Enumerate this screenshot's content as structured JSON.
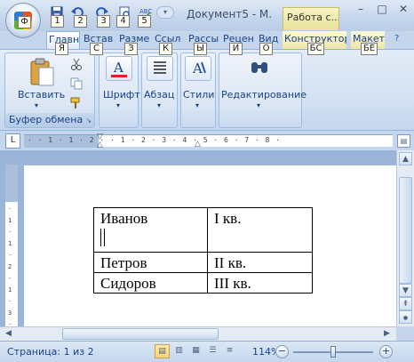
{
  "title": {
    "document": "Документ5 - М.",
    "context_tab": "Работа с...",
    "window_buttons": [
      "–",
      "□",
      "✕"
    ]
  },
  "quick_access": {
    "keytips": [
      "1",
      "2",
      "3",
      "4",
      "5"
    ],
    "office_keytip": "Ф"
  },
  "tabs": [
    {
      "label": "Главн",
      "keytip": "Я"
    },
    {
      "label": "Встав",
      "keytip": "С"
    },
    {
      "label": "Разме",
      "keytip": "З"
    },
    {
      "label": "Ссыл",
      "keytip": "К"
    },
    {
      "label": "Рассы",
      "keytip": "Ы"
    },
    {
      "label": "Рецен",
      "keytip": "И"
    },
    {
      "label": "Вид",
      "keytip": "О"
    },
    {
      "label": "Конструктор",
      "keytip": "БС"
    },
    {
      "label": "Макет",
      "keytip": "БЕ"
    }
  ],
  "ribbon": {
    "paste_label": "Вставить",
    "clipboard_group": "Буфер обмена",
    "font_label": "Шрифт",
    "paragraph_label": "Абзац",
    "styles_label": "Стили",
    "editing_label": "Редактирование"
  },
  "ruler": {
    "tab_button": "L",
    "horizontal": "· · 1 · 1 · 2 ·    · 1 · 2 · 3 · 4 · 5 · 6 · 7 · 8 ·",
    "vertical": "· 1 · 1 · 2 · 1 · 3 · 1 · 4"
  },
  "table": {
    "rows": [
      {
        "name": "Иванов",
        "quarter": "I кв."
      },
      {
        "name": "Петров",
        "quarter": "II кв."
      },
      {
        "name": "Сидоров",
        "quarter": "III кв."
      }
    ]
  },
  "status": {
    "page": "Страница: 1 из 2",
    "zoom": "114%",
    "zoom_level": 1.14
  },
  "colors": {
    "accent": "#15428b",
    "ribbon_bg": "#dbe6f4",
    "context_tab": "#f7f3c4"
  },
  "icons": {
    "office": "office-logo-icon",
    "save": "save-icon",
    "undo": "undo-icon",
    "paste": "paste-icon",
    "font": "font-color-icon",
    "paragraph": "align-icon",
    "styles": "styles-icon",
    "find": "binoculars-icon"
  }
}
